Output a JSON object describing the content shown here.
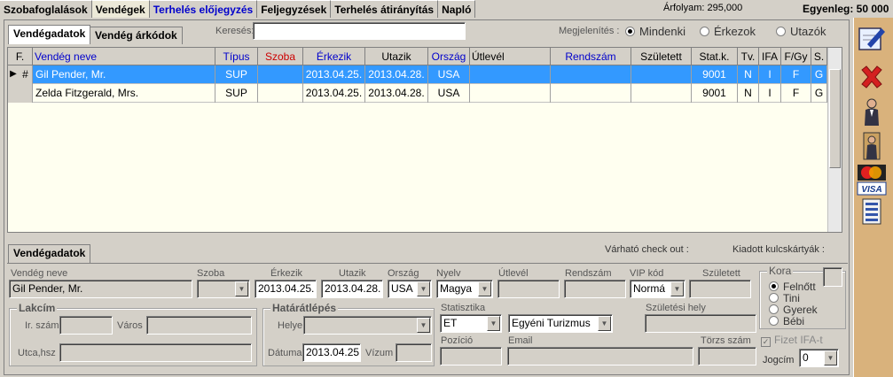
{
  "top_tabs": [
    {
      "label": "Szobafoglalások"
    },
    {
      "label": "Vendégek"
    },
    {
      "label": "Terhelés előjegyzés"
    },
    {
      "label": "Feljegyzések"
    },
    {
      "label": "Terhelés átirányítás"
    },
    {
      "label": "Napló"
    }
  ],
  "exchange_rate": "Árfolyam: 295,000",
  "balance": "Egyenleg: 50 000",
  "sub_tabs": [
    {
      "label": "Vendégadatok"
    },
    {
      "label": "Vendég árkódok"
    }
  ],
  "search": {
    "label": "Keresés:",
    "value": ""
  },
  "display_filter": {
    "label": "Megjelenítés :",
    "options": [
      "Mindenki",
      "Érkezok",
      "Utazók"
    ],
    "selected": "Mindenki"
  },
  "grid": {
    "headers": [
      "F.",
      "Vendég neve",
      "Típus",
      "Szoba",
      "Érkezik",
      "Utazik",
      "Ország",
      "Útlevél",
      "Rendszám",
      "Született",
      "Stat.k.",
      "Tv.",
      "IFA",
      "F/Gy",
      "S."
    ],
    "rows": [
      {
        "f": "#",
        "name": "Gil Pender, Mr.",
        "type": "SUP",
        "room": "",
        "arrive": "2013.04.25.",
        "depart": "2013.04.28.",
        "country": "USA",
        "passport": "",
        "plate": "",
        "born": "",
        "stat": "9001",
        "tv": "N",
        "ifa": "I",
        "fgy": "F",
        "s": "G"
      },
      {
        "f": "",
        "name": "Zelda Fitzgerald, Mrs.",
        "type": "SUP",
        "room": "",
        "arrive": "2013.04.25.",
        "depart": "2013.04.28.",
        "country": "USA",
        "passport": "",
        "plate": "",
        "born": "",
        "stat": "9001",
        "tv": "N",
        "ifa": "I",
        "fgy": "F",
        "s": "G"
      }
    ]
  },
  "details": {
    "tab_label": "Vendégadatok",
    "expected_checkout_label": "Várható check out :",
    "keycards_label": "Kiadott kulcskártyák :",
    "guest_name_label": "Vendég neve",
    "guest_name": "Gil Pender, Mr.",
    "room_label": "Szoba",
    "arrive_label": "Érkezik",
    "arrive": "2013.04.25.",
    "depart_label": "Utazik",
    "depart": "2013.04.28.",
    "country_label": "Ország",
    "country": "USA",
    "language_label": "Nyelv",
    "language": "Magya",
    "passport_label": "Útlevél",
    "plate_label": "Rendszám",
    "vip_label": "VIP kód",
    "vip": "Normá",
    "born_label": "Született",
    "age_group_label": "Kora",
    "age_options": [
      "Felnőtt",
      "Tini",
      "Gyerek",
      "Bébi"
    ],
    "age_selected": "Felnőtt",
    "address_title": "Lakcím",
    "zip_label": "Ir. szám",
    "city_label": "Város",
    "street_label": "Utca,hsz",
    "border_title": "Határátlépés",
    "place_label": "Helye",
    "date_label": "Dátuma",
    "border_date": "2013.04.25",
    "visa_label": "Vízum",
    "stat_label": "Statisztika",
    "stat": "ET",
    "stat_desc": "Egyéni Turizmus",
    "birthplace_label": "Születési hely",
    "position_label": "Pozíció",
    "email_label": "Email",
    "master_label": "Törzs szám",
    "ifa_label": "Fizet IFA-t",
    "title_label": "Jogcím",
    "title_value": "0"
  },
  "toolbar_icons": [
    "edit-icon",
    "delete-icon",
    "guest-icon",
    "guest-checkout-icon",
    "credit-card-icon",
    "list-icon"
  ],
  "colors": {
    "selected_row": "#3399ff",
    "toolbar": "#d9b27c",
    "grid_bg": "#fffff0",
    "header_blue": "#0000cc",
    "header_red": "#cc0000"
  }
}
